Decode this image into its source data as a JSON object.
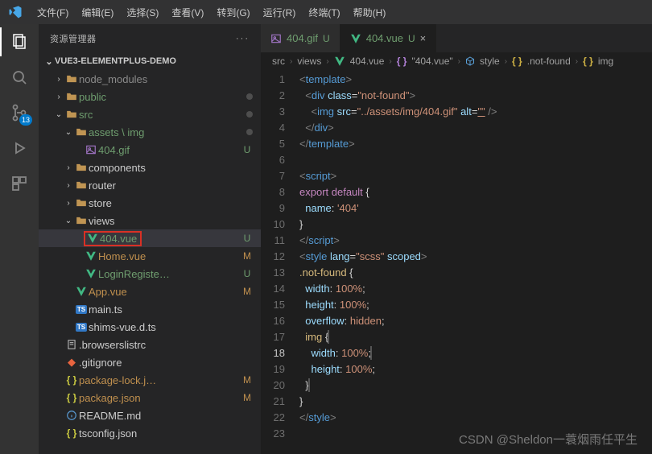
{
  "menu": [
    "文件(F)",
    "编辑(E)",
    "选择(S)",
    "查看(V)",
    "转到(G)",
    "运行(R)",
    "终端(T)",
    "帮助(H)"
  ],
  "activity": {
    "scm_badge": "13"
  },
  "sidebar": {
    "title": "资源管理器",
    "section": "VUE3-ELEMENTPLUS-DEMO",
    "items": [
      {
        "indent": 1,
        "twist": ">",
        "type": "folder",
        "label": "node_modules",
        "dim": true
      },
      {
        "indent": 1,
        "twist": ">",
        "type": "folder",
        "label": "public",
        "cls": "U",
        "dot": true
      },
      {
        "indent": 1,
        "twist": "v",
        "type": "folder-open",
        "label": "src",
        "cls": "U",
        "dot": true
      },
      {
        "indent": 2,
        "twist": "v",
        "type": "folder-open",
        "label": "assets \\ img",
        "cls": "U",
        "dot": true
      },
      {
        "indent": 3,
        "twist": "",
        "type": "image",
        "label": "404.gif",
        "cls": "U",
        "status": "U"
      },
      {
        "indent": 2,
        "twist": ">",
        "type": "folder",
        "label": "components"
      },
      {
        "indent": 2,
        "twist": ">",
        "type": "folder",
        "label": "router"
      },
      {
        "indent": 2,
        "twist": ">",
        "type": "folder",
        "label": "store"
      },
      {
        "indent": 2,
        "twist": "v",
        "type": "folder-open",
        "label": "views"
      },
      {
        "indent": 3,
        "twist": "",
        "type": "vue",
        "label": "404.vue",
        "cls": "U",
        "status": "U",
        "sel": true,
        "box": true
      },
      {
        "indent": 3,
        "twist": "",
        "type": "vue",
        "label": "Home.vue",
        "cls": "M",
        "status": "M"
      },
      {
        "indent": 3,
        "twist": "",
        "type": "vue",
        "label": "LoginRegister.vue",
        "cls": "U",
        "status": "U"
      },
      {
        "indent": 2,
        "twist": "",
        "type": "vue",
        "label": "App.vue",
        "cls": "M",
        "status": "M"
      },
      {
        "indent": 2,
        "twist": "",
        "type": "ts",
        "label": "main.ts"
      },
      {
        "indent": 2,
        "twist": "",
        "type": "ts",
        "label": "shims-vue.d.ts"
      },
      {
        "indent": 1,
        "twist": "",
        "type": "file",
        "label": ".browserslistrc"
      },
      {
        "indent": 1,
        "twist": "",
        "type": "git",
        "label": ".gitignore"
      },
      {
        "indent": 1,
        "twist": "",
        "type": "json",
        "label": "package-lock.json",
        "cls": "M",
        "status": "M"
      },
      {
        "indent": 1,
        "twist": "",
        "type": "json",
        "label": "package.json",
        "cls": "M",
        "status": "M"
      },
      {
        "indent": 1,
        "twist": "",
        "type": "info",
        "label": "README.md"
      },
      {
        "indent": 1,
        "twist": "",
        "type": "json",
        "label": "tsconfig.json"
      }
    ]
  },
  "tabs": [
    {
      "icon": "image",
      "label": "404.gif",
      "letter": "U",
      "active": false
    },
    {
      "icon": "vue",
      "label": "404.vue",
      "letter": "U",
      "active": true,
      "close": true
    }
  ],
  "crumbs": [
    {
      "icon": "",
      "text": "src"
    },
    {
      "icon": "",
      "text": "views"
    },
    {
      "icon": "vue",
      "text": "404.vue"
    },
    {
      "icon": "braces",
      "text": "\"404.vue\""
    },
    {
      "icon": "cube",
      "text": "style"
    },
    {
      "icon": "brace-y",
      "text": ".not-found"
    },
    {
      "icon": "brace-y",
      "text": "img"
    }
  ],
  "code": {
    "current": 18,
    "lines": [
      "<[template]>",
      "  <[div] @class=$\"not-found\"$>",
      "    <[img] @src=$\"../assets/img/404.gif\"$~ @alt=$\"\"$ />",
      "  </[div]>",
      "</[template]>",
      "",
      "<[script]>",
      "^export default^ {",
      "  @name: $'404'$",
      "}",
      "</[script]>",
      "<[style] @lang=$\"scss\"$ @scoped>",
      "%.not-found% {",
      "  @width: #100%#;",
      "  @height: #100%#;",
      "  @overflow: #hidden#;",
      "  %img% {|",
      "    @width: #100%#;|",
      "    @height: #100%#;",
      "  }|",
      "}",
      "</[style]>",
      ""
    ]
  },
  "watermark": "CSDN @Sheldon一蓑烟雨任平生"
}
